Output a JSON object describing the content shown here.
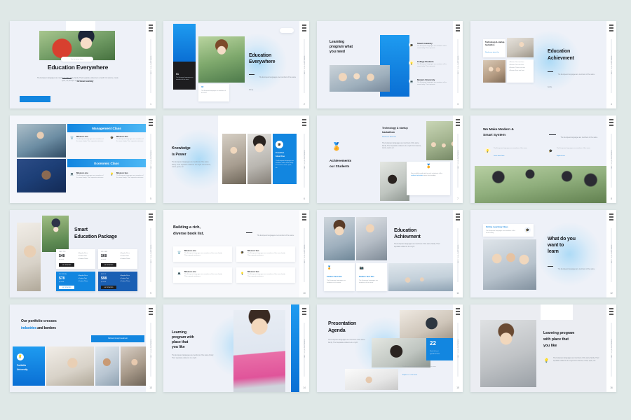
{
  "meta": {
    "background": "#dfe8e7",
    "accent": "#1286e0",
    "slide_count": 16
  },
  "common": {
    "rail_vtext": "www.yoursite.com",
    "body_lorem": "The European languages are members of the same family. Their separate existence is a myth. For science, music, sport, etc, Europe uses the same vocabulary.",
    "body_lorem_short": "The European languages are members of the same family.",
    "body_lorem_mid": "The European languages are members of the same family. Their separate existence is a myth."
  },
  "slides": [
    {
      "n": "01",
      "badge": "For the better future",
      "title": "Education Everywhere",
      "subtitle": "All About Learning",
      "body": "The European languages are members of the same family. Their separate existence is a myth. For science, music, sport, etc, Europe uses the same vocabulary.",
      "page": "1"
    },
    {
      "n": "02",
      "title_l1": "Education",
      "title_l2": "Everywhere",
      "body": "The European languages are members of the same family.",
      "tag": "Read More",
      "card1_num": "01",
      "card1_label": "The European languages are members of the same",
      "card2_label": "The European languages are members of the same",
      "page": "2"
    },
    {
      "n": "03",
      "title_l1": "Learning",
      "title_l2": "program what",
      "title_l3": "you need",
      "items": [
        {
          "icon": "graduation-cap",
          "label": "Smart Academy",
          "body": "The European languages are members of the same family. Their separate."
        },
        {
          "icon": "lightbulb",
          "label": "College Students",
          "body": "The European languages are members of the same family. Their separate."
        },
        {
          "icon": "laptop",
          "label": "Modern University",
          "body": "The European languages are members of the same family. Their separate."
        }
      ],
      "page": "3"
    },
    {
      "n": "04",
      "card_title": "Technology & startup hackathon",
      "card_sub": "Read more about this",
      "title_l1": "Education",
      "title_l2": "Achievment",
      "body": "The European languages are members of the same family.",
      "list": [
        "Mission One text here",
        "Mission Two text here",
        "Mission Three text here",
        "Mission Four text here"
      ],
      "page": "4"
    },
    {
      "n": "05",
      "band1": "Management Class",
      "band2": "Economic Class",
      "cells": [
        {
          "icon": "trash",
          "label": "Mission one",
          "body": "The European languages are members of the same family. Their separate existence."
        },
        {
          "icon": "graduation-cap",
          "label": "Mission two",
          "body": "The European languages are members of the same family. Their separate existence."
        },
        {
          "icon": "laptop",
          "label": "Mission one",
          "body": "The European languages are members of the same family. Their separate existence."
        },
        {
          "icon": "lightbulb",
          "label": "Mission two",
          "body": "The European languages are members of the same family. Their separate existence."
        }
      ],
      "page": "5"
    },
    {
      "n": "06",
      "title_l1": "Knowledge",
      "title_l2": "is Power",
      "body": "The European languages are members of the same family. Their separate existence is a myth. For science, music, sport, etc.",
      "panel_title_l1": "Creative",
      "panel_title_l2": "Idea One",
      "panel_body": "The European languages are members of the same family. For science, music, sport, etc.",
      "page": "6"
    },
    {
      "n": "07",
      "card_title_l1": "Technology & startup",
      "card_title_l2": "hackathon",
      "card_link": "Read more about this",
      "card_body": "The European languages are members of the same family. Their separate existence is a myth. For science, music, sport, etc.",
      "title_l1": "Achievements",
      "title_l2": "our Students",
      "note_body": "Successfully conducted to each instalment of the",
      "note_highlight": "resilient hackathon",
      "note_body2": "series last monday.",
      "page": "7"
    },
    {
      "n": "08",
      "title_l1": "We Make Modern &",
      "title_l2": "Smart System",
      "intro": "The European languages are members of the same.",
      "items": [
        {
          "icon": "lightbulb",
          "body": "The European languages are members of the same.",
          "link": "Learn more here"
        },
        {
          "icon": "graduation-cap",
          "body": "The European languages are members of the same.",
          "link": "Explore here"
        }
      ],
      "page": "8"
    },
    {
      "n": "09",
      "title_l1": "Smart",
      "title_l2": "Education Package",
      "plans": [
        {
          "tag": "START PRO",
          "price": "$48",
          "per": "per month",
          "btn": "GET STARTED",
          "features": [
            "Regular Price",
            "Custom Text",
            "Custom Three",
            "Custom Four"
          ],
          "theme": "light"
        },
        {
          "tag": "MID CLASS",
          "price": "$68",
          "per": "per month",
          "btn": "GET STARTED",
          "features": [
            "Regular Price",
            "Custom Text",
            "Custom Three",
            "Custom Four"
          ],
          "theme": "light"
        },
        {
          "tag": "PRO SPECIAL",
          "price": "$78",
          "per": "per month",
          "btn": "GET STARTED",
          "features": [
            "Regular Price",
            "Custom Text",
            "Custom Three",
            "Custom Four"
          ],
          "theme": "blue"
        },
        {
          "tag": "BEST FIT",
          "price": "$98",
          "per": "per month",
          "btn": "GET STARTED",
          "features": [
            "Regular Price",
            "Custom Text",
            "Custom Three",
            "Custom Four"
          ],
          "theme": "navy"
        }
      ],
      "page": "9"
    },
    {
      "n": "10",
      "title_l1": "Building a rich,",
      "title_l2": "diverse book list.",
      "intro": "The European languages are members of the same.",
      "cards": [
        {
          "icon": "trash",
          "label": "Mission one",
          "body": "The European languages are members of the same family. Their separate existence."
        },
        {
          "icon": "graduation-cap",
          "label": "Mission two",
          "body": "The European languages are members of the same family. Their separate existence."
        },
        {
          "icon": "laptop",
          "label": "Mission one",
          "body": "The European languages are members of the same family. Their separate existence."
        },
        {
          "icon": "lightbulb",
          "label": "Mission two",
          "body": "The European languages are members of the same family. Their separate existence."
        }
      ],
      "page": "10"
    },
    {
      "n": "11",
      "title_l1": "Education",
      "title_l2": "Achievment",
      "body": "The European languages are members of the same family. Their separate existence is a myth.",
      "cards": [
        {
          "icon": "medal",
          "label": "Feature Text One",
          "body": "The European languages are members of the same."
        },
        {
          "icon": "camera",
          "label": "Feature Text Two",
          "body": "The European languages are members of the same."
        }
      ],
      "page": "11"
    },
    {
      "n": "12",
      "card_title": "Online Learning Class",
      "card_body": "The European languages are members of the same family.",
      "title_l1": "What do you",
      "title_l2": "want to",
      "title_l3": "learn",
      "body": "The European languages are members of the same.",
      "page": "12"
    },
    {
      "n": "13",
      "title_l1": "Our portfolio crosses",
      "title_hl": "industries",
      "title_l2": " and borders",
      "btn": "Partners Group Investment",
      "tile_icon": "lightbulb",
      "tile_l1": "Portfolio",
      "tile_l2": "University",
      "page": "13"
    },
    {
      "n": "14",
      "title_l1": "Learning",
      "title_l2": "program with",
      "title_l3": "place that",
      "title_l4": "you like",
      "body": "The European languages are members of the same family. Their separate existence is a myth.",
      "page": "14"
    },
    {
      "n": "15",
      "title_l1": "Presentation",
      "title_l2": "Agenda",
      "body": "The European languages are members of the same family. Their separate existence is a myth.",
      "stat_num": "22",
      "stat_l1": "Read the best",
      "stat_l2": "agenda list here",
      "note": "The European languages are members of the same.",
      "note_links": "Explore it · Learn more",
      "page": "15"
    },
    {
      "n": "16",
      "title_l1": "Learning program",
      "title_l2": "with place that",
      "title_l3": "you like",
      "icon": "lightbulb",
      "body": "The European languages are members of the same family. Their separate existence is a myth. For science, music, sport, etc.",
      "page": "16"
    }
  ]
}
